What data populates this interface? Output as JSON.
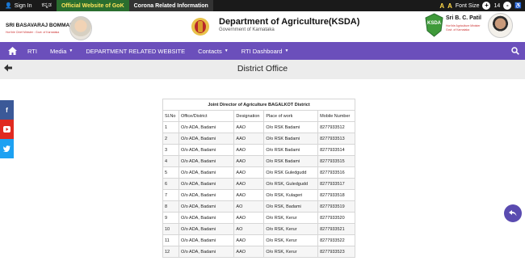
{
  "topbar": {
    "sign_in": "Sign In",
    "kannada": "ಕನ್ನಡ",
    "gok": "Official Website of GoK",
    "corona": "Corona Related Information",
    "font_a1": "A",
    "font_a2": "A",
    "font_size_label": "Font Size",
    "font_plus": "+",
    "font_value": "14",
    "font_minus": "-",
    "accessibility": "♿"
  },
  "header": {
    "cm_name": "SRI BASAVARAJ BOMMAI",
    "cm_sub": "Hon'ble Chief Minister : Govt. of Karnataka",
    "dept_title": "Department of Agriculture(KSDA)",
    "dept_sub": "Government of Karnataka",
    "minister_name": "Sri B. C. Patil",
    "minister_sub": "Hon'ble Agriculture Minister Govt. of Karnataka",
    "ksda_logo_text": "KSDA"
  },
  "nav": {
    "items": [
      "RTI",
      "Media",
      "DEPARTMENT RELATED WEBSITE",
      "Contacts",
      "RTI Dashboard"
    ]
  },
  "page": {
    "title": "District Office"
  },
  "table": {
    "caption": "Joint Director of Agriculture BAGALKOT District",
    "headers": [
      "Sl.No",
      "Office/District",
      "Designation",
      "Place of work",
      "Mobile Number"
    ],
    "rows": [
      [
        "1",
        "O/o ADA, Badami",
        "AAO",
        "O/o RSK Badami",
        "8277933512"
      ],
      [
        "2",
        "O/o ADA, Badami",
        "AAO",
        "O/o RSK Badami",
        "8277933513"
      ],
      [
        "3",
        "O/o ADA, Badami",
        "AAO",
        "O/o RSK Badami",
        "8277933514"
      ],
      [
        "4",
        "O/o ADA, Badami",
        "AAO",
        "O/o RSK Badami",
        "8277933515"
      ],
      [
        "5",
        "O/o ADA, Badami",
        "AAO",
        "O/o RSK Guledgudd",
        "8277933516"
      ],
      [
        "6",
        "O/o ADA, Badami",
        "AAO",
        "O/o RSK, Guledgudd",
        "8277933517"
      ],
      [
        "7",
        "O/o ADA, Badami",
        "AAO",
        "O/o RSK, Kulageri",
        "8277933518"
      ],
      [
        "8",
        "O/o ADA, Badami",
        "AO",
        "O/o RSK, Badami",
        "8277933519"
      ],
      [
        "9",
        "O/o ADA, Badami",
        "AAO",
        "O/o RSK, Kerur",
        "8277933520"
      ],
      [
        "10",
        "O/o ADA, Badami",
        "AO",
        "O/o RSK, Kerur",
        "8277933521"
      ],
      [
        "11",
        "O/o ADA, Badami",
        "AAO",
        "O/o RSK, Kerur",
        "8277933522"
      ],
      [
        "12",
        "O/o ADA, Badami",
        "AAO",
        "O/o RSK, Kerur",
        "8277933523"
      ]
    ]
  },
  "colors": {
    "nav_bg": "#6b4fbb",
    "facebook": "#3b5998",
    "youtube": "#e02a20",
    "twitter": "#1da1f2"
  },
  "icons": {
    "home": "home-icon",
    "search": "search-icon",
    "back": "arrow-left-icon",
    "facebook": "facebook-icon",
    "youtube": "youtube-icon",
    "twitter": "twitter-icon",
    "fab": "undo-icon"
  }
}
